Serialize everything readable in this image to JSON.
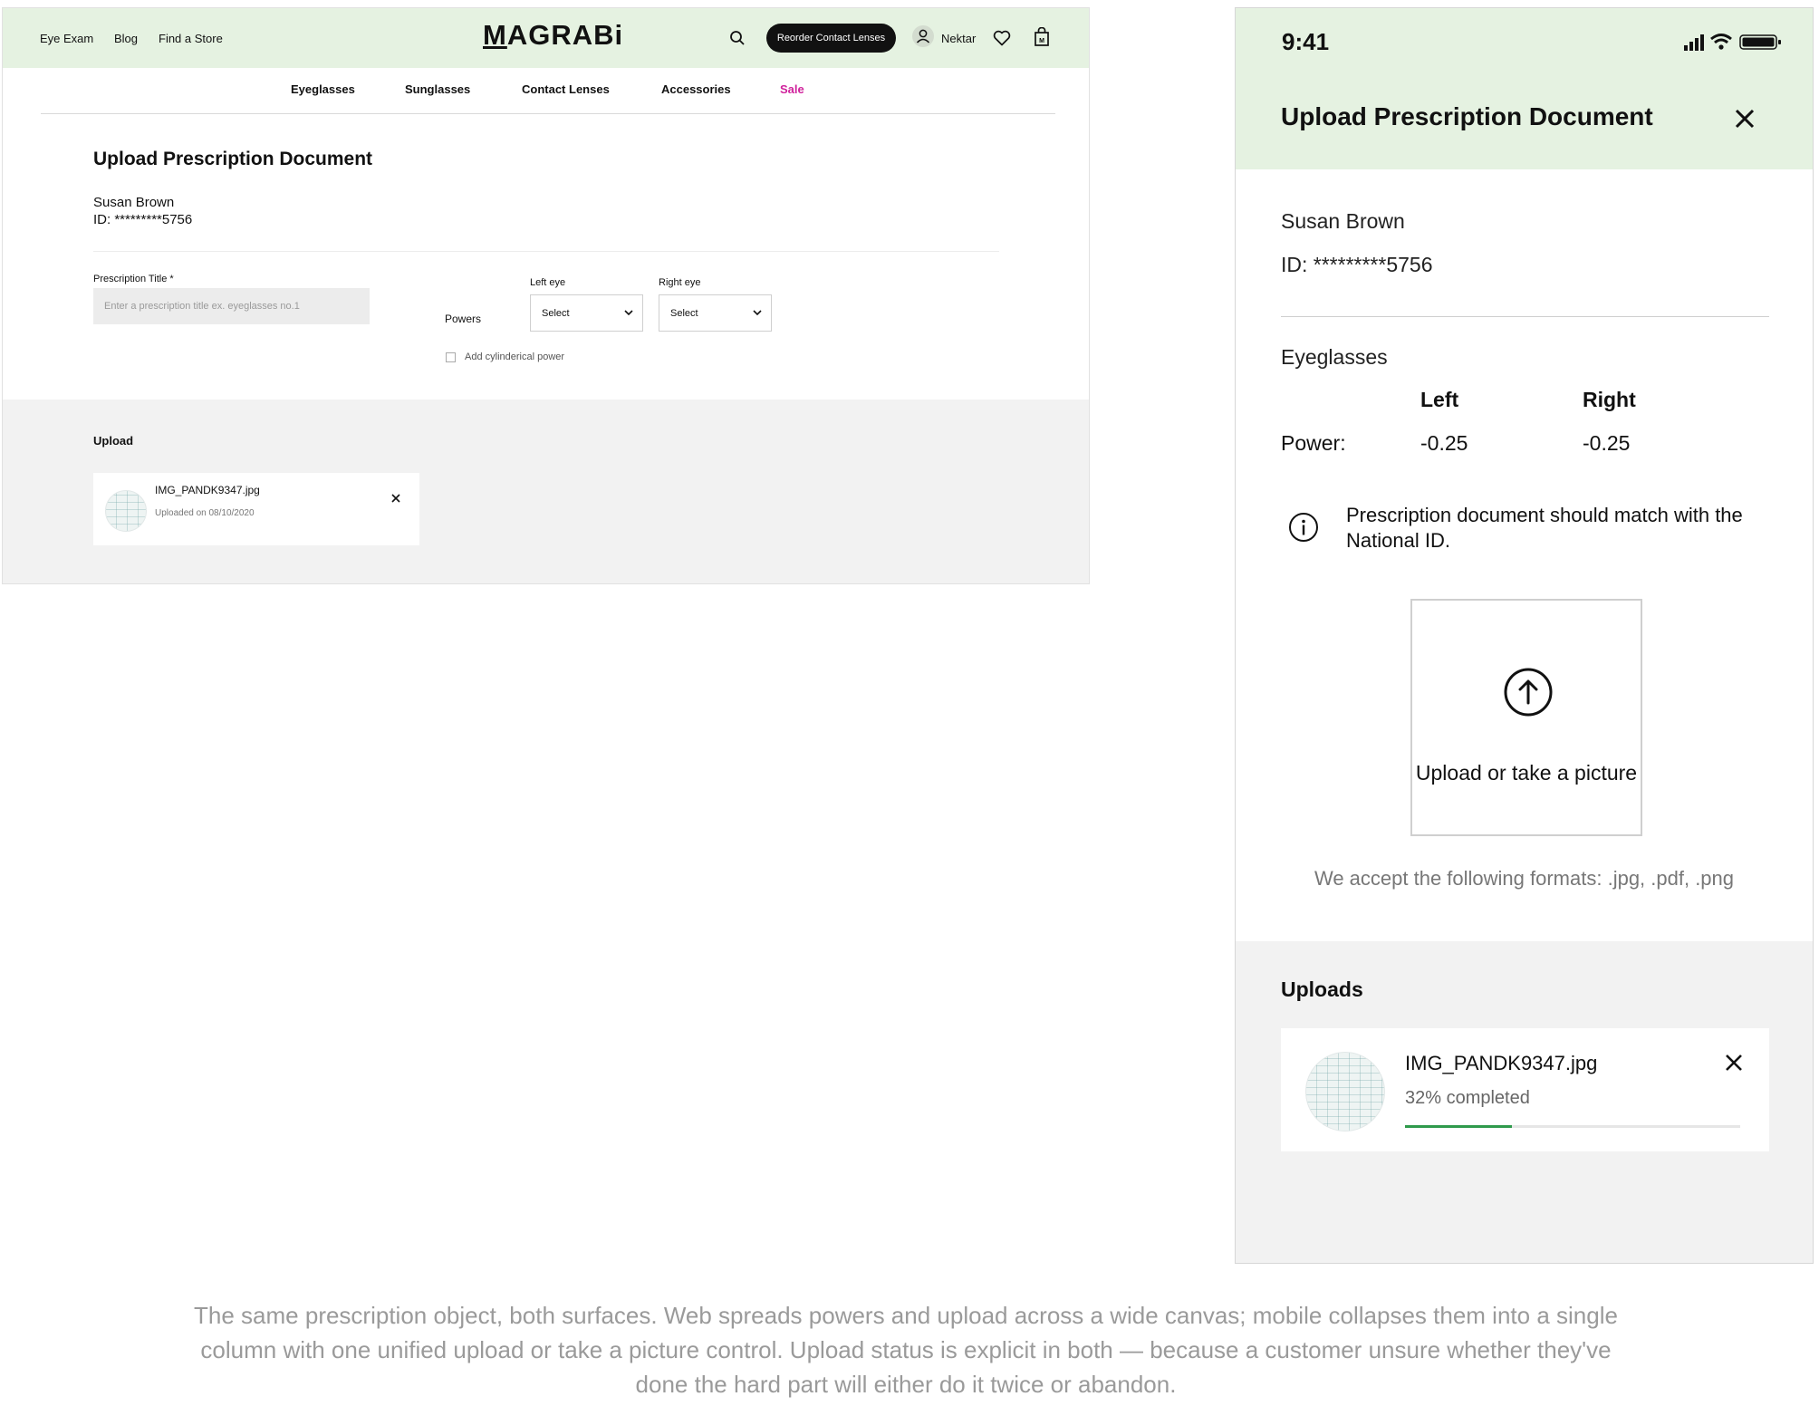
{
  "web": {
    "top_links": [
      "Eye Exam",
      "Blog",
      "Find a Store"
    ],
    "logo": "MAGRABi",
    "reorder_button": "Reorder Contact Lenses",
    "user_name": "Nektar",
    "icons": [
      "search-icon",
      "user-icon",
      "heart-icon",
      "bag-icon"
    ],
    "nav": [
      "Eyeglasses",
      "Sunglasses",
      "Contact Lenses",
      "Accessories",
      "Sale"
    ],
    "sale_color": "#d0229c",
    "page_title": "Upload Prescription Document",
    "patient_name": "Susan Brown",
    "patient_id": "ID: *********5756",
    "form": {
      "title_label": "Prescription Title *",
      "title_placeholder": "Enter a prescription title ex. eyeglasses no.1",
      "left_eye_label": "Left eye",
      "right_eye_label": "Right eye",
      "powers_label": "Powers",
      "left_select": "Select",
      "right_select": "Select",
      "cyl_label": "Add cylinderical power"
    },
    "upload": {
      "label": "Upload",
      "file_name": "IMG_PANDK9347.jpg",
      "file_date": "Uploaded on 08/10/2020"
    }
  },
  "mobile": {
    "time": "9:41",
    "title": "Upload Prescription Document",
    "patient_name": "Susan Brown",
    "patient_id": "ID: *********5756",
    "section": "Eyeglasses",
    "col_left": "Left",
    "col_right": "Right",
    "row_label": "Power:",
    "power_left": "-0.25",
    "power_right": "-0.25",
    "info": "Prescription document should match with the National ID.",
    "upload_cta": "Upload or take a picture",
    "formats": "We accept the following formats: .jpg, .pdf, .png",
    "uploads_label": "Uploads",
    "file_name": "IMG_PANDK9347.jpg",
    "progress_text": "32% completed",
    "progress": 0.32,
    "progress_color": "#2f9a4c"
  },
  "theme": {
    "header_bg": "#e5f2e1",
    "upload_bg": "#f2f2f2"
  },
  "caption": "The same prescription object, both surfaces. Web spreads powers and upload across a wide canvas; mobile collapses them into a single column with one unified upload or take a picture control. Upload status is explicit in both — because a customer unsure whether they've done the hard part will either do it twice or abandon."
}
